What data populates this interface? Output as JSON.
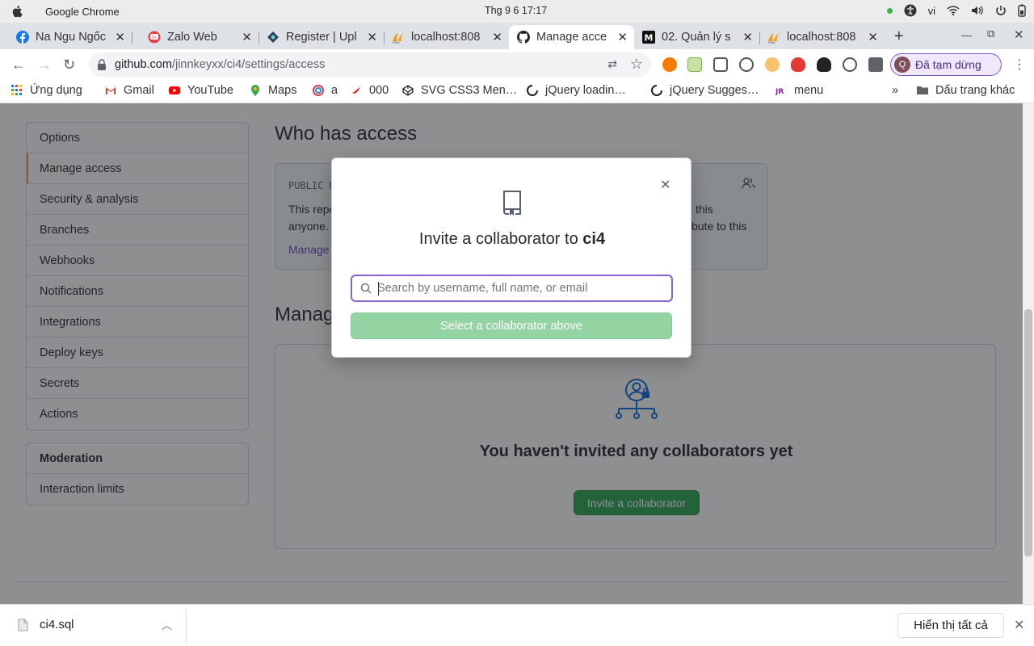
{
  "os": {
    "app_name": "Google Chrome",
    "clock": "Thg 9 6  17:17",
    "lang": "vi"
  },
  "tabs": [
    {
      "label": "Na Ngu Ngốc",
      "icon": "facebook-icon"
    },
    {
      "label": "Zalo Web",
      "icon": "zalo-icon"
    },
    {
      "label": "Register | Upl",
      "icon": "upwork-icon"
    },
    {
      "label": "localhost:808",
      "icon": "phpmyadmin-icon"
    },
    {
      "label": "Manage acce",
      "icon": "github-icon",
      "active": true
    },
    {
      "label": "02. Quản lý s",
      "icon": "medium-icon"
    },
    {
      "label": "localhost:808",
      "icon": "phpmyadmin-icon"
    }
  ],
  "address": {
    "host": "github.com",
    "path": "/jinnkeyxx/ci4/settings/access"
  },
  "profile": {
    "initial": "Q",
    "label": "Đã tạm dừng"
  },
  "bookmarks": [
    {
      "label": "Ứng dụng",
      "icon": "apps-grid-icon"
    },
    {
      "label": "Gmail",
      "icon": "gmail-icon"
    },
    {
      "label": "YouTube",
      "icon": "youtube-icon"
    },
    {
      "label": "Maps",
      "icon": "maps-icon"
    },
    {
      "label": "a",
      "icon": "swirl-icon"
    },
    {
      "label": "000",
      "icon": "bird-icon"
    },
    {
      "label": "SVG CSS3 Men…",
      "icon": "codepen-icon"
    },
    {
      "label": "jQuery loadin…",
      "icon": "spinner-icon"
    },
    {
      "label": "jQuery Sugges…",
      "icon": "spinner-icon"
    },
    {
      "label": "menu",
      "icon": "jr-icon"
    },
    {
      "label": "»",
      "icon": ""
    },
    {
      "label": "Dấu trang khác",
      "icon": "folder-icon"
    }
  ],
  "sidebar": {
    "items": [
      "Options",
      "Manage access",
      "Security & analysis",
      "Branches",
      "Webhooks",
      "Notifications",
      "Integrations",
      "Deploy keys",
      "Secrets",
      "Actions"
    ],
    "moderation_title": "Moderation",
    "moderation_items": [
      "Interaction limits"
    ]
  },
  "main": {
    "who_title": "Who has access",
    "public_label": "PUBLIC R",
    "public_text": "This repo… anyone. … this … bute to this",
    "public_line1": "This repo",
    "public_line1b": "this",
    "public_line2": "anyone.",
    "public_line2b": "bute to this",
    "manage_link": "Manage",
    "manage_title": "Manag",
    "empty_text": "You haven't invited any collaborators yet",
    "invite_button": "Invite a collaborator"
  },
  "modal": {
    "title_prefix": "Invite a collaborator to",
    "repo": "ci4",
    "search_placeholder": "Search by username, full name, or email",
    "select_button": "Select a collaborator above"
  },
  "downloads": {
    "file": "ci4.sql",
    "show_all": "Hiển thị tất cả"
  }
}
